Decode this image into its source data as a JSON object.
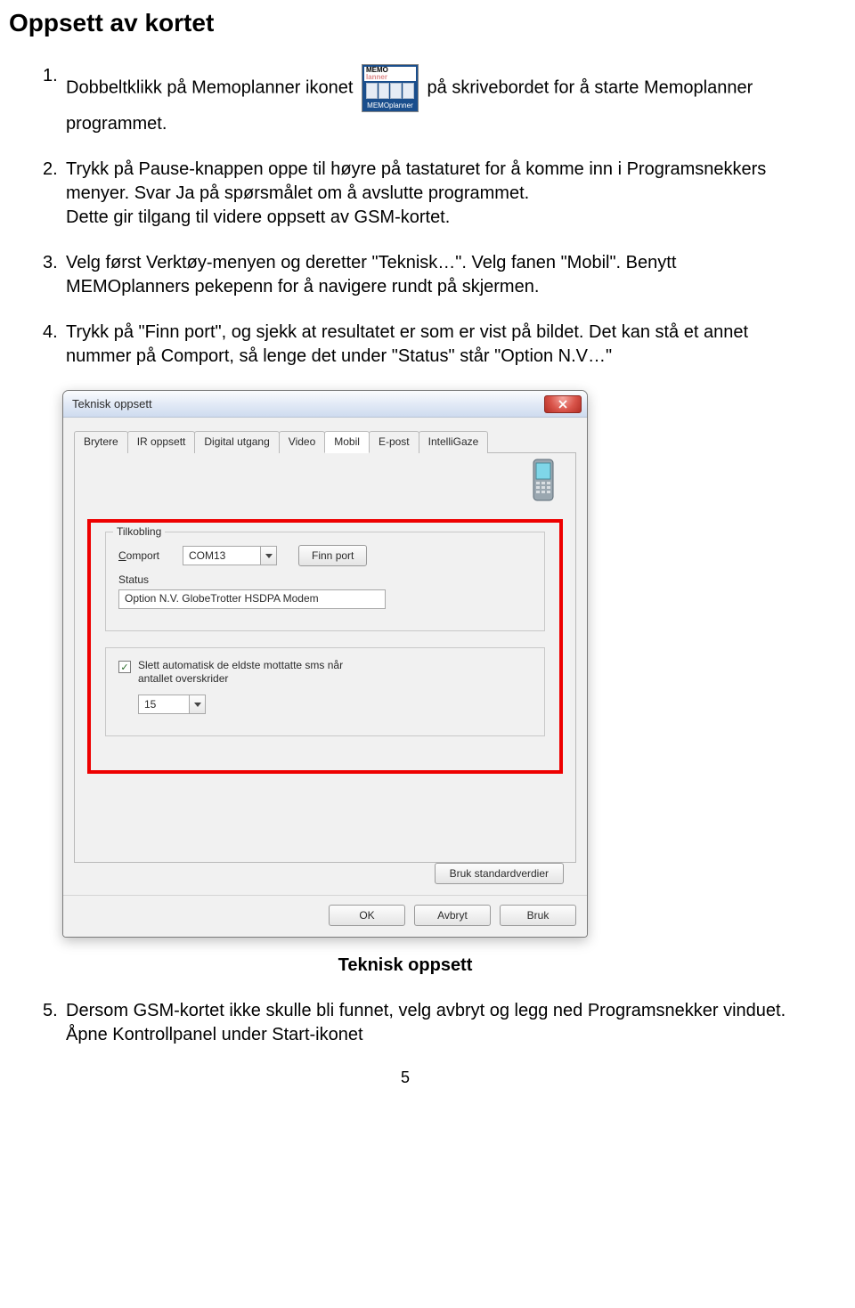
{
  "page_title": "Oppsett av kortet",
  "steps": [
    {
      "num": "1.",
      "text_before": "Dobbeltklikk på Memoplanner ikonet ",
      "text_after": " på skrivebordet for å starte Memoplanner programmet.",
      "has_icon": true
    },
    {
      "num": "2.",
      "text": "Trykk på Pause-knappen oppe til høyre på tastaturet for å komme inn i Programsnekkers menyer. Svar Ja på spørsmålet om å avslutte programmet.\nDette gir tilgang til videre oppsett av GSM-kortet."
    },
    {
      "num": "3.",
      "text": "Velg først Verktøy-menyen og deretter \"Teknisk…\". Velg fanen \"Mobil\". Benytt  MEMOplanners pekepenn for å navigere rundt på skjermen."
    },
    {
      "num": "4.",
      "text": "Trykk på \"Finn port\", og sjekk at resultatet er som er vist på bildet. Det kan stå et annet nummer på Comport, så lenge det under \"Status\" står \"Option N.V…\""
    }
  ],
  "dialog": {
    "title": "Teknisk oppsett",
    "tabs": [
      "Brytere",
      "IR oppsett",
      "Digital utgang",
      "Video",
      "Mobil",
      "E-post",
      "IntelliGaze"
    ],
    "active_tab": 4,
    "group_title": "Tilkobling",
    "comport_label": "Comport",
    "comport_value": "COM13",
    "findport_btn": "Finn port",
    "status_label": "Status",
    "status_value": "Option N.V. GlobeTrotter HSDPA Modem",
    "checkbox_text": "Slett automatisk de eldste mottatte sms når antallet overskrider",
    "checkbox_value": "15",
    "defaults_btn": "Bruk standardverdier",
    "ok_btn": "OK",
    "cancel_btn": "Avbryt",
    "apply_btn": "Bruk"
  },
  "icon": {
    "line1a": "MEMO",
    "line1b": "lanner",
    "footer": "MEMOplanner"
  },
  "figure_caption": "Teknisk oppsett",
  "step5": {
    "num": "5.",
    "text": "Dersom GSM-kortet ikke skulle bli funnet, velg avbryt og legg ned Programsnekker vinduet. Åpne Kontrollpanel under Start-ikonet"
  },
  "page_number": "5"
}
